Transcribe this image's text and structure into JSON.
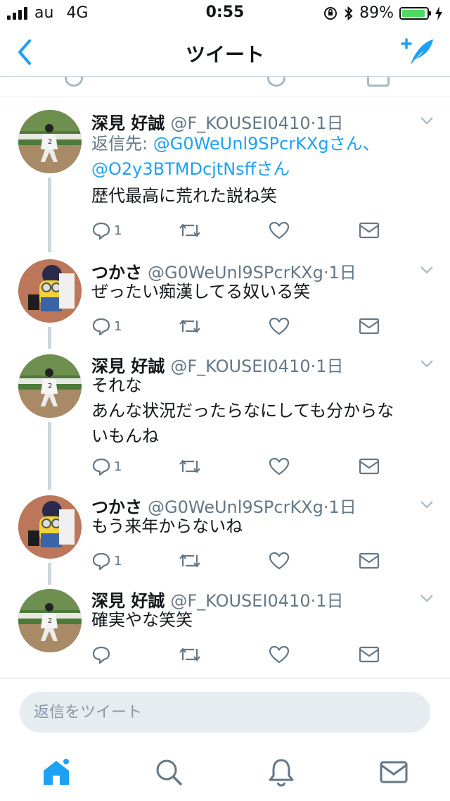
{
  "status_bar": {
    "carrier": "au",
    "network": "4G",
    "time": "0:55",
    "battery": "89%",
    "battery_color": "#4cd964"
  },
  "nav": {
    "title": "ツイート",
    "back_icon": "chevron-left-icon",
    "compose_icon": "compose-quill-icon"
  },
  "tweets": [
    {
      "name": "深見 好誠",
      "handle": "@F_KOUSEI0410",
      "time": "·1日",
      "reply_prefix": "返信先: ",
      "reply_link_1": "@G0WeUnl9SPcrKXgさん、",
      "reply_link_2": "@O2y3BTMDcjtNsffさん",
      "text": "歴代最高に荒れた説ね笑",
      "reply_count": "1"
    },
    {
      "name": "つかさ",
      "handle": "@G0WeUnl9SPcrKXg",
      "time": "·1日",
      "text": "ぜったい痴漢してる奴いる笑",
      "reply_count": "1"
    },
    {
      "name": "深見 好誠",
      "handle": "@F_KOUSEI0410",
      "time": "·1日",
      "text_line1": "それな",
      "text_line2": "あんな状況だったらなにしても分からな",
      "text_line3": "いもんね",
      "reply_count": "1"
    },
    {
      "name": "つかさ",
      "handle": "@G0WeUnl9SPcrKXg",
      "time": "·1日",
      "text": "もう来年からないね",
      "reply_count": "1"
    },
    {
      "name": "深見 好誠",
      "handle": "@F_KOUSEI0410",
      "time": "·1日",
      "text": "確実やな笑笑",
      "reply_count": ""
    }
  ],
  "composer": {
    "placeholder": "返信をツイート"
  },
  "tabs": [
    "home-icon",
    "search-icon",
    "notifications-bell-icon",
    "messages-envelope-icon"
  ],
  "colors": {
    "accent": "#1da1f2",
    "muted": "#657786",
    "icon": "#8899a6",
    "thread_line": "#ccd6dd"
  }
}
